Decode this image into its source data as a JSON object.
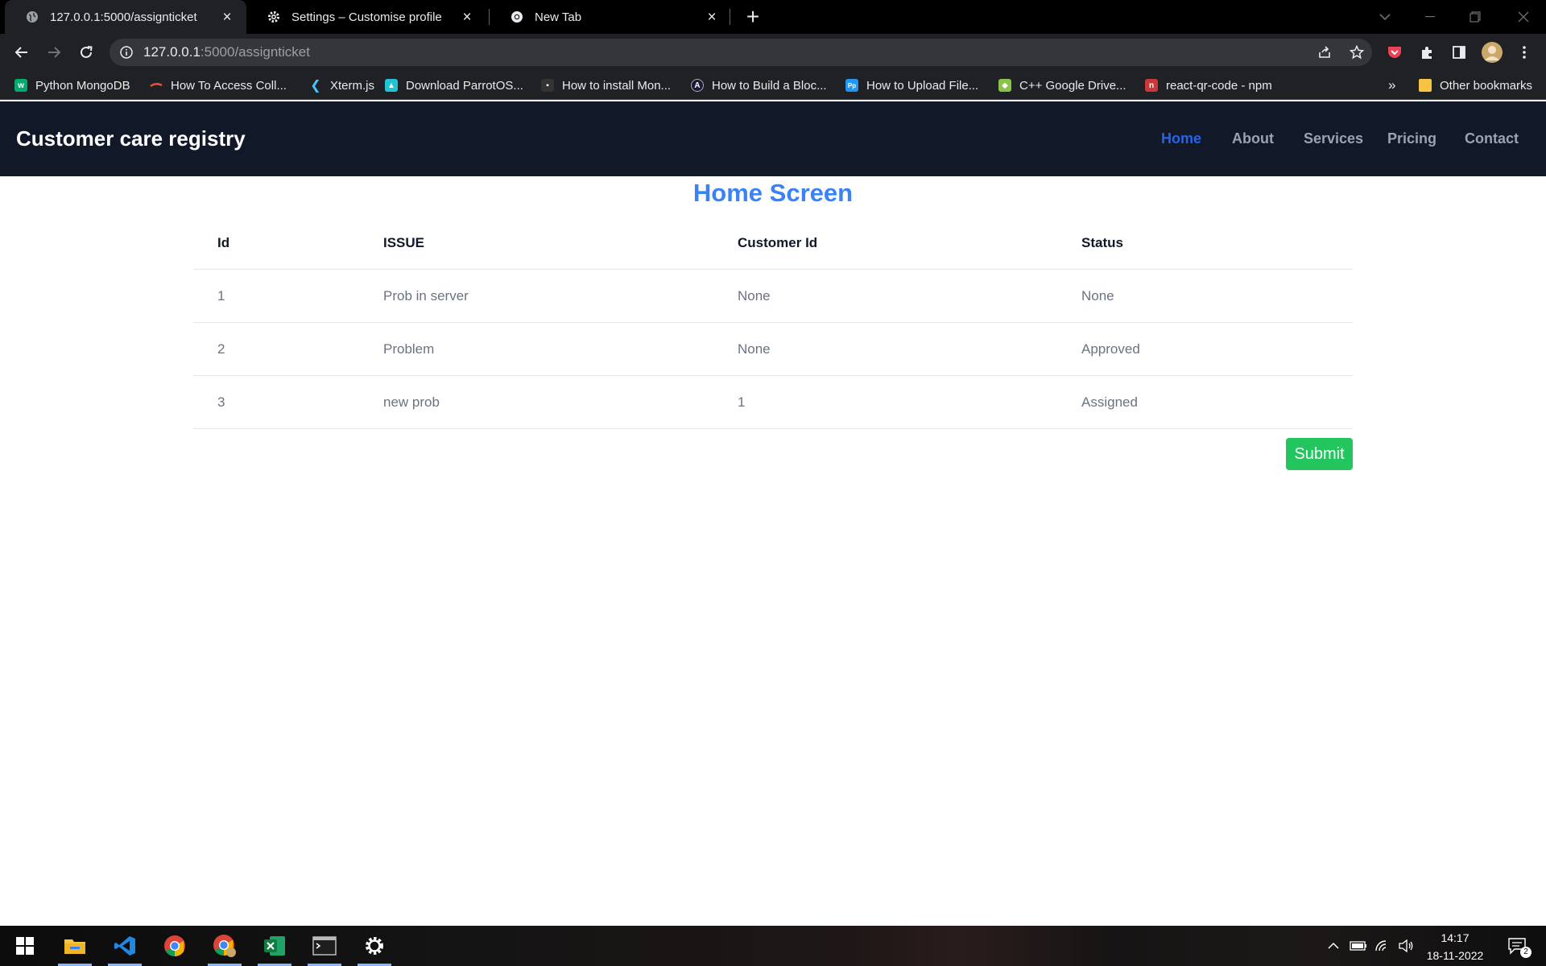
{
  "browser": {
    "tabs": [
      {
        "title": "127.0.0.1:5000/assignticket",
        "active": true
      },
      {
        "title": "Settings – Customise profile",
        "active": false
      },
      {
        "title": "New Tab",
        "active": false
      }
    ],
    "address": {
      "host": "127.0.0.1",
      "path": ":5000/assignticket"
    },
    "bookmarks": [
      {
        "label": "Python MongoDB",
        "icon": "w3schools-icon",
        "color": "#04aa6d"
      },
      {
        "label": "How To Access Coll...",
        "icon": "digitalocean-icon",
        "color": "#e8533a"
      },
      {
        "label": "Xterm.js",
        "icon": "xterm-icon",
        "color": "#4fc3f7"
      },
      {
        "label": "Download ParrotOS...",
        "icon": "parrot-icon",
        "color": "#21c3d7"
      },
      {
        "label": "How to install Mon...",
        "icon": "mongo-icon",
        "color": "#333333"
      },
      {
        "label": "How to Build a Bloc...",
        "icon": "algorand-icon",
        "color": "#1a1a3a"
      },
      {
        "label": "How to Upload File...",
        "icon": "pp-icon",
        "color": "#2196f3"
      },
      {
        "label": "C++ Google Drive...",
        "icon": "gdrive-cpp-icon",
        "color": "#8bc34a"
      },
      {
        "label": "react-qr-code - npm",
        "icon": "npm-icon",
        "color": "#cb3837"
      }
    ],
    "overflow_label": "»",
    "other_bookmarks": "Other bookmarks"
  },
  "page": {
    "brand": "Customer care registry",
    "nav": [
      "Home",
      "About",
      "Services",
      "Pricing",
      "Contact"
    ],
    "active_nav": "Home",
    "heading": "Home Screen",
    "table": {
      "headers": [
        "Id",
        "ISSUE",
        "Customer Id",
        "Status"
      ],
      "rows": [
        [
          "1",
          "Prob in server",
          "None",
          "None"
        ],
        [
          "2",
          "Problem",
          "None",
          "Approved"
        ],
        [
          "3",
          "new prob",
          "1",
          "Assigned"
        ]
      ]
    },
    "submit_label": "Submit"
  },
  "taskbar": {
    "time": "14:17",
    "date": "18-11-2022",
    "notification_count": "2"
  },
  "colors": {
    "navbar_bg": "#111827",
    "nav_active": "#2563eb",
    "heading": "#3b82f6",
    "submit_bg": "#22c55e"
  }
}
